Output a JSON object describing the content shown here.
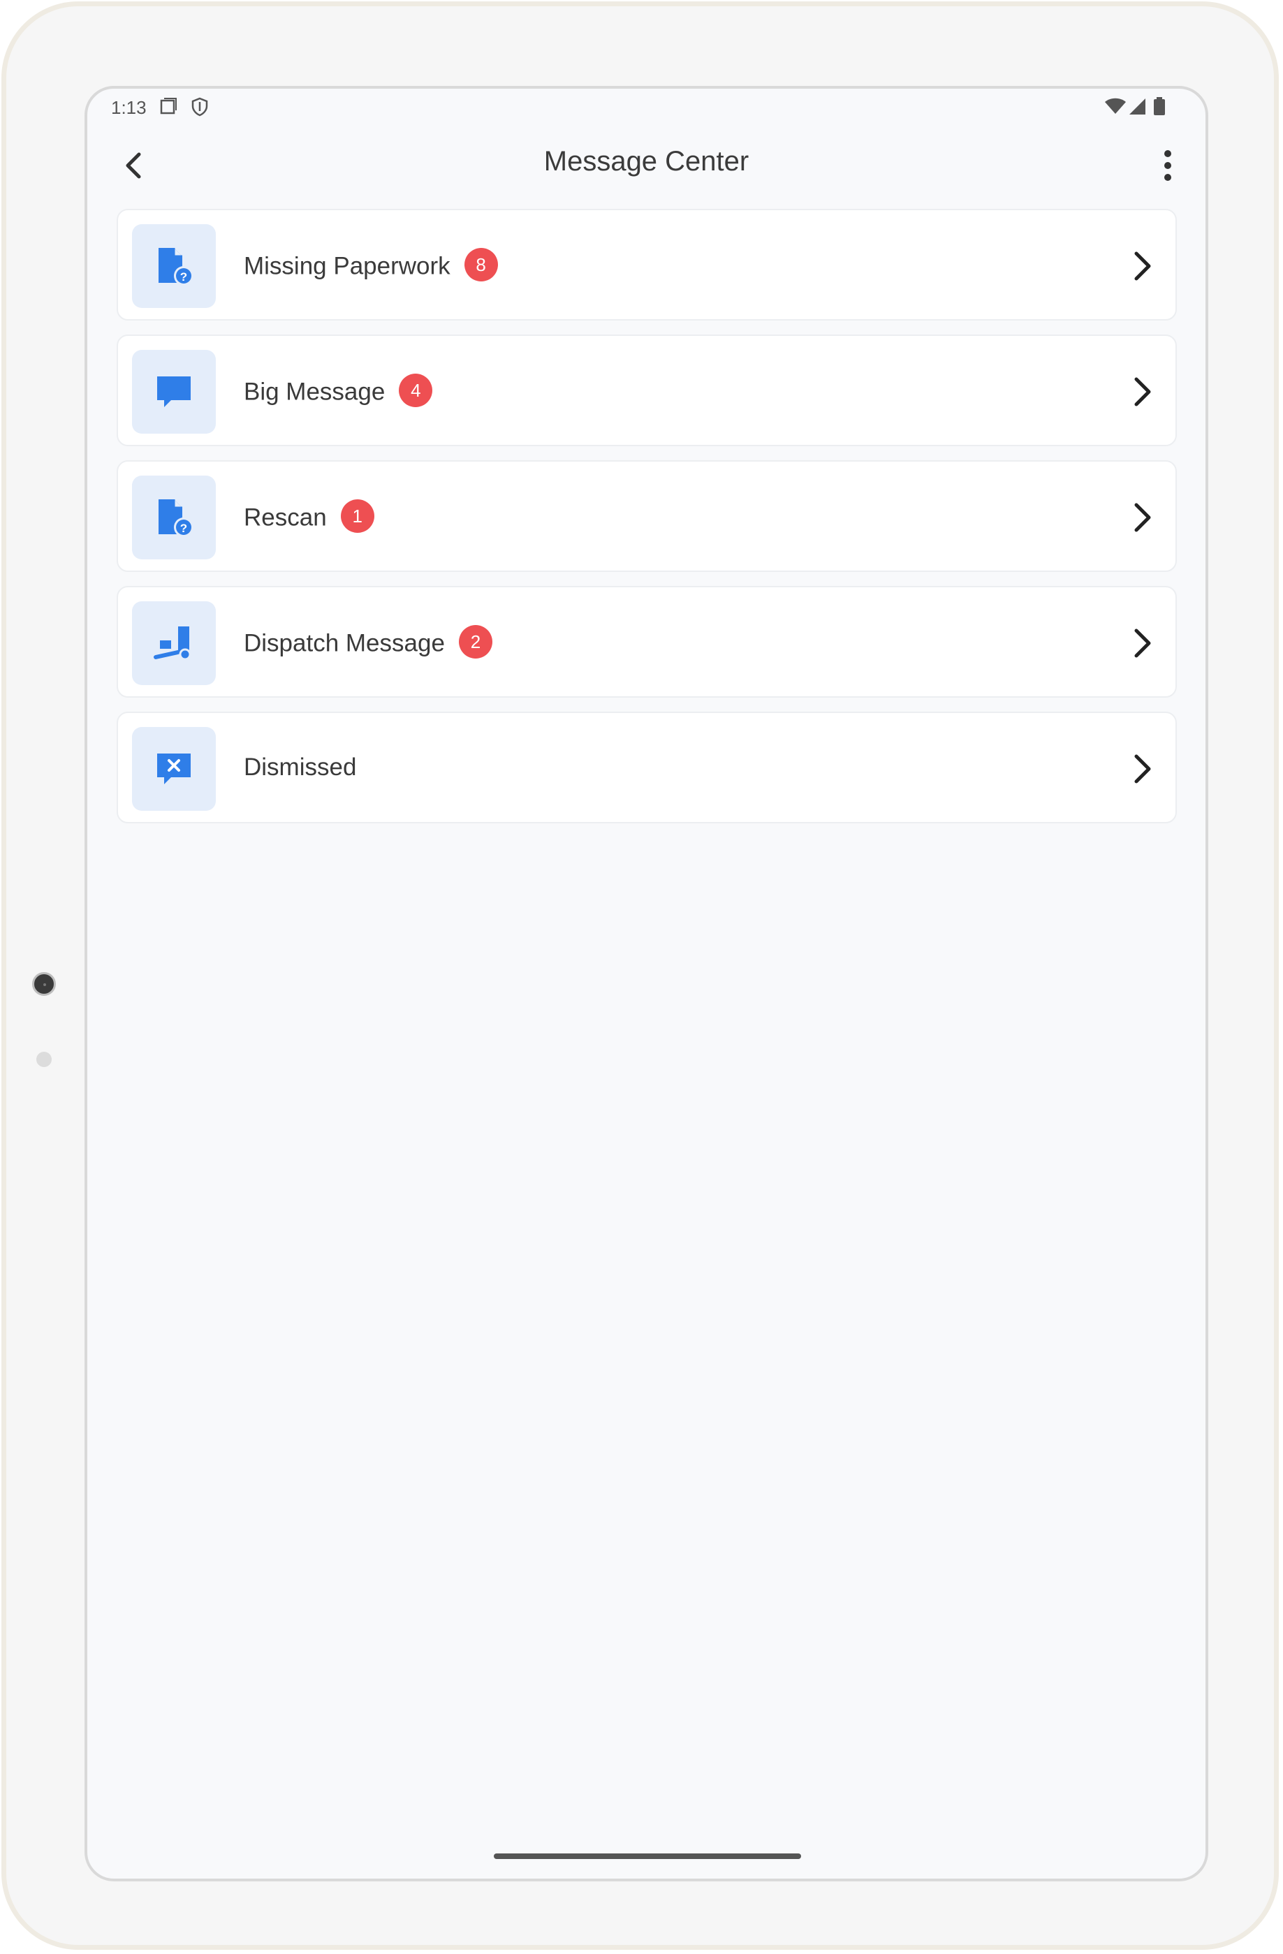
{
  "status_bar": {
    "time": "1:13",
    "left_icons": [
      "screenshot-icon",
      "shield-icon"
    ],
    "right_icons": [
      "wifi-icon",
      "signal-icon",
      "battery-icon"
    ]
  },
  "header": {
    "title": "Message Center",
    "back_icon": "back-arrow-icon",
    "menu_icon": "more-vert-icon"
  },
  "items": [
    {
      "label": "Missing Paperwork",
      "badge": "8",
      "icon": "document-question-icon"
    },
    {
      "label": "Big Message",
      "badge": "4",
      "icon": "chat-bubble-icon"
    },
    {
      "label": "Rescan",
      "badge": "1",
      "icon": "document-question-icon"
    },
    {
      "label": "Dispatch Message",
      "badge": "2",
      "icon": "truck-icon"
    },
    {
      "label": "Dismissed",
      "badge": null,
      "icon": "chat-close-icon"
    }
  ],
  "colors": {
    "accent": "#2f7ee8",
    "icon_tile": "#e4edfa",
    "badge": "#ee4f52"
  }
}
